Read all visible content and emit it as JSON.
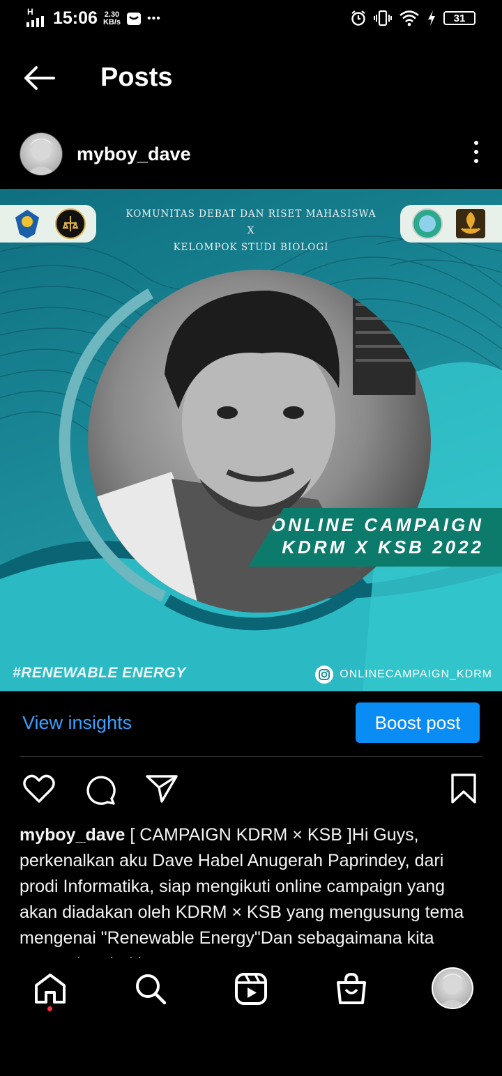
{
  "status_bar": {
    "network": "H",
    "time": "15:06",
    "speed_value": "2.30",
    "speed_unit": "KB/s",
    "more": "•••",
    "battery": "31"
  },
  "header": {
    "title": "Posts"
  },
  "post": {
    "username": "myboy_dave",
    "image": {
      "org_line1": "KOMUNITAS DEBAT DAN RISET MAHASISWA",
      "org_line2": "X",
      "org_line3": "KELOMPOK STUDI BIOLOGI",
      "campaign_line1": "ONLINE CAMPAIGN",
      "campaign_line2": "KDRM X KSB 2022",
      "hashtag": "#RENEWABLE ENERGY",
      "ig_handle": "ONLINECAMPAIGN_KDRM"
    },
    "view_insights": "View insights",
    "boost_post": "Boost post",
    "caption_username": "myboy_dave",
    "caption_text": " [ CAMPAIGN KDRM × KSB ]Hi Guys, perkenalkan aku Dave Habel Anugerah Paprindey, dari prodi Informatika, siap mengikuti online campaign yang akan diadakan oleh KDRM × KSB yang mengusung tema mengenai \"Renewable Energy\"Dan sebagaimana kita semua ketahui bersama"
  },
  "colors": {
    "link": "#3aa1ff",
    "boost_button": "#0a8cf5",
    "image_teal": "#1e8f9d",
    "campaign_banner": "#0d7b6b"
  }
}
